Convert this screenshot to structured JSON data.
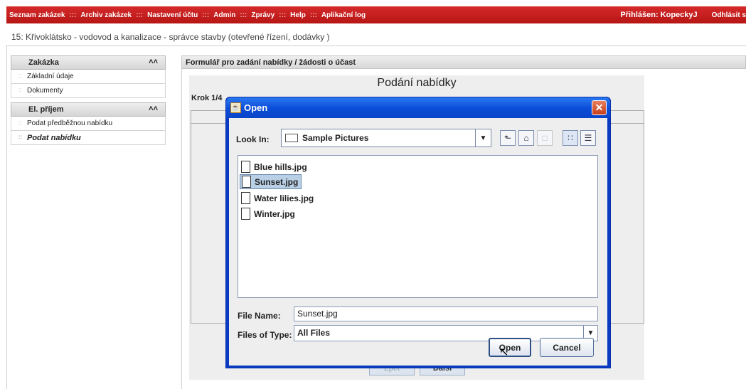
{
  "topbar": {
    "nav": [
      "Seznam zakázek",
      "Archiv zakázek",
      "Nastavení účtu",
      "Admin",
      "Zprávy",
      "Help",
      "Aplikační log"
    ],
    "separator": ":::",
    "user": "Přihlášen: KopeckyJ",
    "logout": "Odhlásit s"
  },
  "breadcrumb": "15: Křivoklátsko - vodovod a kanalizace - správce stavby (otevřené řízení, dodávky )",
  "sidebar": {
    "groups": [
      {
        "title": "Zakázka",
        "items": [
          "Základní údaje",
          "Dokumenty"
        ]
      },
      {
        "title": "El. příjem",
        "items": [
          "Podat předběžnou nabídku",
          "Podat nabídku"
        ]
      }
    ],
    "chevron": "«"
  },
  "form": {
    "header": "Formulář pro zadání nabídky / žádosti o účast",
    "title": "Podání nabídky",
    "step": "Krok 1/4",
    "back_button": "Zpět",
    "next_button": "Další"
  },
  "dialog": {
    "title": "Open",
    "look_in_label": "Look In:",
    "look_in_value": "Sample Pictures",
    "files": [
      "Blue hills.jpg",
      "Sunset.jpg",
      "Water lilies.jpg",
      "Winter.jpg"
    ],
    "selected_file": "Sunset.jpg",
    "file_name_label": "File Name:",
    "file_name_value": "Sunset.jpg",
    "files_of_type_label": "Files of Type:",
    "files_of_type_value": "All Files",
    "open_button": "Open",
    "cancel_button": "Cancel"
  }
}
